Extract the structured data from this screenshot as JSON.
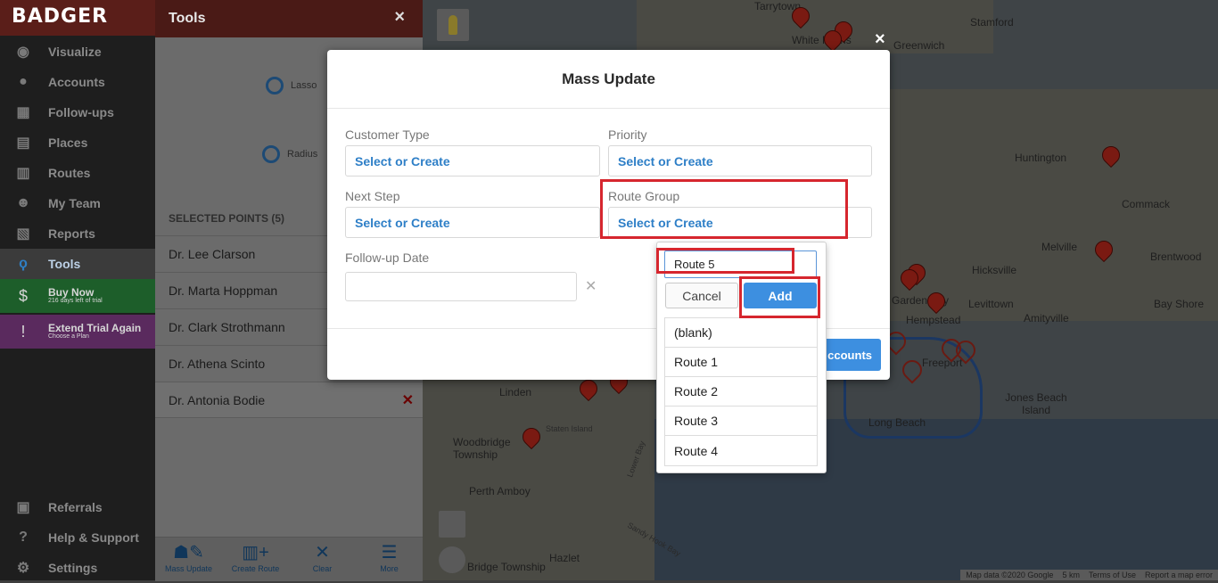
{
  "app": {
    "logo": "BADGER"
  },
  "sidebar": {
    "items": [
      {
        "label": "Visualize",
        "icon": "eye-icon"
      },
      {
        "label": "Accounts",
        "icon": "user-circle-icon"
      },
      {
        "label": "Follow-ups",
        "icon": "calendar-icon"
      },
      {
        "label": "Places",
        "icon": "store-icon"
      },
      {
        "label": "Routes",
        "icon": "map-icon"
      },
      {
        "label": "My Team",
        "icon": "team-icon"
      },
      {
        "label": "Reports",
        "icon": "report-icon"
      },
      {
        "label": "Tools",
        "icon": "lasso-icon",
        "active": true
      }
    ],
    "buy_now": {
      "title": "Buy Now",
      "subtitle": "216 days left of trial"
    },
    "extend_trial": {
      "title": "Extend Trial Again",
      "subtitle": "Choose a Plan"
    },
    "bottom": [
      {
        "label": "Referrals",
        "icon": "gift-icon"
      },
      {
        "label": "Help & Support",
        "icon": "help-icon"
      },
      {
        "label": "Settings",
        "icon": "gear-icon"
      }
    ]
  },
  "tools": {
    "title": "Tools",
    "close": "×",
    "lasso": "Lasso",
    "radius": "Radius",
    "selected_header": "SELECTED POINTS (5)",
    "points": [
      "Dr. Lee Clarson",
      "Dr. Marta Hoppman",
      "Dr. Clark Strothmann",
      "Dr. Athena Scinto",
      "Dr. Antonia Bodie"
    ],
    "remove": "✕",
    "footer": [
      {
        "label": "Mass Update",
        "icon": "user-edit-icon"
      },
      {
        "label": "Create Route",
        "icon": "map-plus-icon"
      },
      {
        "label": "Clear",
        "icon": "clear-icon"
      },
      {
        "label": "More",
        "icon": "menu-icon"
      }
    ]
  },
  "map": {
    "labels": [
      "Tarrytown",
      "White Plains",
      "Stamford",
      "Greenwich",
      "Huntington",
      "Commack",
      "Melville",
      "Brentwood",
      "Hicksville",
      "Levittown",
      "Bay Shore",
      "Amityville",
      "Hempstead",
      "Garden City",
      "Freeport",
      "Long Beach",
      "Jones Beach Island",
      "Linden",
      "Staten Island",
      "Woodbridge Township",
      "Perth Amboy",
      "Hazlet",
      "Bridge Township",
      "Lower Bay",
      "Sandy Hook Bay"
    ],
    "footer": [
      "Map data ©2020 Google",
      "5 km",
      "Terms of Use",
      "Report a map error"
    ]
  },
  "modal": {
    "title": "Mass Update",
    "close": "×",
    "fields": {
      "customer_type": {
        "label": "Customer Type",
        "value": "Select or Create"
      },
      "priority": {
        "label": "Priority",
        "value": "Select or Create"
      },
      "next_step": {
        "label": "Next Step",
        "value": "Select or Create"
      },
      "route_group": {
        "label": "Route Group",
        "value": "Select or Create"
      },
      "followup_date": {
        "label": "Follow-up Date",
        "value": "",
        "clear": "✕"
      }
    },
    "update_button": "ccounts"
  },
  "dropdown": {
    "input_value": "Route 5",
    "cancel": "Cancel",
    "add": "Add",
    "options": [
      "(blank)",
      "Route 1",
      "Route 2",
      "Route 3",
      "Route 4"
    ]
  },
  "colors": {
    "accent": "#3d8fe0",
    "highlight": "#d6262e",
    "link": "#2e7fc7"
  }
}
